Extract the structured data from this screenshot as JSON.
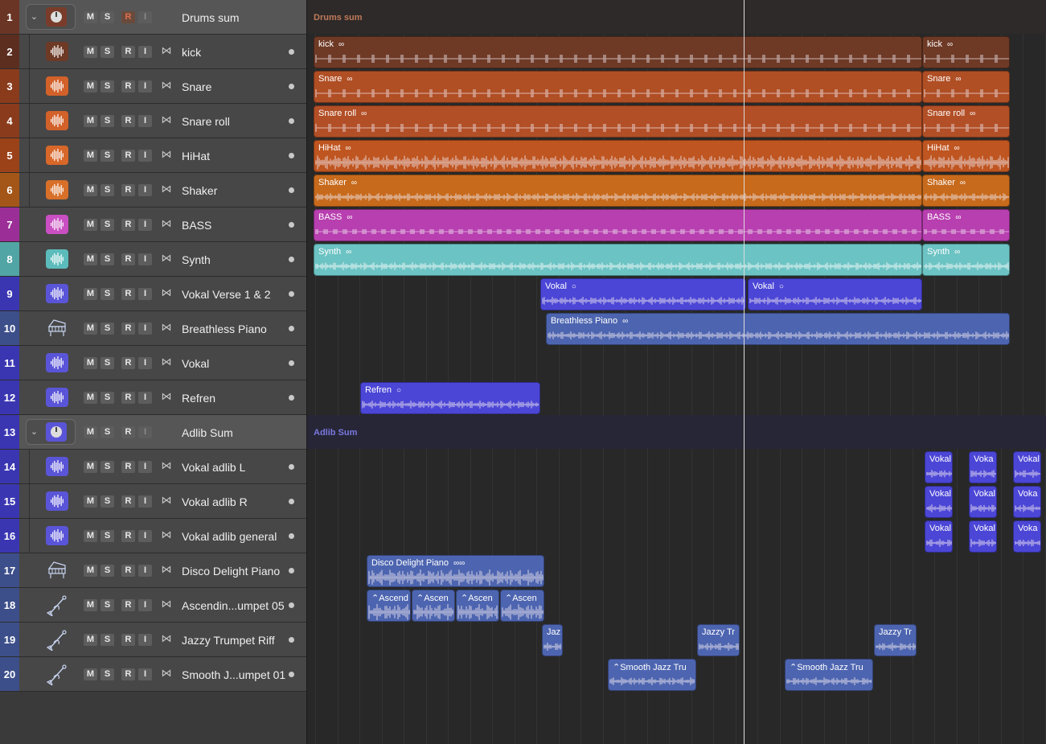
{
  "colors": {
    "drums_folder_icon": "#7a3c2a",
    "kick": "#6e3a26",
    "snare": "#b04e24",
    "snare_roll": "#b24f26",
    "hihat": "#bf5520",
    "shaker": "#c76a1c",
    "bass": "#b83fb0",
    "synth": "#6cc3c3",
    "vocal": "#4b46d6",
    "piano": "#4d65b0",
    "playhead": "#dcdcdc"
  },
  "buttons": {
    "mute": "M",
    "solo": "S",
    "rec": "R",
    "input": "I"
  },
  "tracks": [
    {
      "num": "1",
      "name": "Drums sum",
      "type": "folder",
      "icon": "drum-summing-icon",
      "numColor": "#6b3525"
    },
    {
      "num": "2",
      "name": "kick",
      "type": "audio",
      "icon": "waveform-icon",
      "numColor": "#5b2e20",
      "iconColor": "#6e3a26"
    },
    {
      "num": "3",
      "name": "Snare",
      "type": "audio",
      "icon": "waveform-icon",
      "numColor": "#8a3b1c",
      "iconColor": "#d2612a"
    },
    {
      "num": "4",
      "name": "Snare roll",
      "type": "audio",
      "icon": "waveform-icon",
      "numColor": "#8a3b1c",
      "iconColor": "#d2612a"
    },
    {
      "num": "5",
      "name": "HiHat",
      "type": "audio",
      "icon": "waveform-icon",
      "numColor": "#9c4219",
      "iconColor": "#d8672a"
    },
    {
      "num": "6",
      "name": "Shaker",
      "type": "audio",
      "icon": "waveform-icon",
      "numColor": "#a45618",
      "iconColor": "#d8702a"
    },
    {
      "num": "7",
      "name": "BASS",
      "type": "audio",
      "icon": "waveform-icon",
      "numColor": "#9c2f97",
      "iconColor": "#c94fc2"
    },
    {
      "num": "8",
      "name": "Synth",
      "type": "audio",
      "icon": "waveform-icon",
      "numColor": "#52a5a5",
      "iconColor": "#5cbcbc"
    },
    {
      "num": "9",
      "name": "Vokal Verse 1 & 2",
      "type": "audio",
      "icon": "waveform-icon",
      "numColor": "#3a36b2",
      "iconColor": "#5a55d8"
    },
    {
      "num": "10",
      "name": "Breathless Piano",
      "type": "instrument",
      "icon": "piano-icon",
      "numColor": "#3d4f8a"
    },
    {
      "num": "11",
      "name": "Vokal",
      "type": "audio",
      "icon": "waveform-icon",
      "numColor": "#3a36b2",
      "iconColor": "#5a55d8"
    },
    {
      "num": "12",
      "name": "Refren",
      "type": "audio",
      "icon": "waveform-icon",
      "numColor": "#3a36b2",
      "iconColor": "#5a55d8"
    },
    {
      "num": "13",
      "name": "Adlib Sum",
      "type": "folder",
      "icon": "summing-icon",
      "numColor": "#3a36b2"
    },
    {
      "num": "14",
      "name": "Vokal adlib L",
      "type": "audio",
      "icon": "waveform-icon",
      "numColor": "#3a36b2",
      "iconColor": "#5a55d8"
    },
    {
      "num": "15",
      "name": "Vokal adlib R",
      "type": "audio",
      "icon": "waveform-icon",
      "numColor": "#3a36b2",
      "iconColor": "#5a55d8"
    },
    {
      "num": "16",
      "name": "Vokal adlib general",
      "type": "audio",
      "icon": "waveform-icon",
      "numColor": "#3a36b2",
      "iconColor": "#5a55d8"
    },
    {
      "num": "17",
      "name": "Disco Delight Piano",
      "type": "instrument",
      "icon": "piano-icon",
      "numColor": "#3d4f8a"
    },
    {
      "num": "18",
      "name": "Ascendin...umpet 05",
      "type": "instrument",
      "icon": "trumpet-icon",
      "numColor": "#3d4f8a"
    },
    {
      "num": "19",
      "name": "Jazzy Trumpet Riff",
      "type": "instrument",
      "icon": "trumpet-icon",
      "numColor": "#3d4f8a"
    },
    {
      "num": "20",
      "name": "Smooth J...umpet 01",
      "type": "instrument",
      "icon": "trumpet-icon",
      "numColor": "#3d4f8a"
    }
  ],
  "summing": [
    {
      "track": 1,
      "label": "Drums sum",
      "labelColor": "#c0795a",
      "bg": "#2d2a29"
    },
    {
      "track": 13,
      "label": "Adlib Sum",
      "labelColor": "#7a78e0",
      "bg": "#262636"
    }
  ],
  "regions": [
    {
      "track": 2,
      "label": "kick",
      "loop": "∞",
      "color": "#6e3a26",
      "start": 0,
      "end": 757
    },
    {
      "track": 2,
      "label": "kick",
      "loop": "∞",
      "color": "#6e3a26",
      "start": 757,
      "end": 866
    },
    {
      "track": 3,
      "label": "Snare",
      "loop": "∞",
      "color": "#b04e24",
      "start": 0,
      "end": 757
    },
    {
      "track": 3,
      "label": "Snare",
      "loop": "∞",
      "color": "#b04e24",
      "start": 757,
      "end": 866
    },
    {
      "track": 4,
      "label": "Snare roll",
      "loop": "∞",
      "color": "#b24f26",
      "start": 0,
      "end": 757
    },
    {
      "track": 4,
      "label": "Snare roll",
      "loop": "∞",
      "color": "#b24f26",
      "start": 757,
      "end": 866
    },
    {
      "track": 5,
      "label": "HiHat",
      "loop": "∞",
      "color": "#bf5520",
      "start": 0,
      "end": 757
    },
    {
      "track": 5,
      "label": "HiHat",
      "loop": "∞",
      "color": "#bf5520",
      "start": 757,
      "end": 866
    },
    {
      "track": 6,
      "label": "Shaker",
      "loop": "∞",
      "color": "#c76a1c",
      "start": 0,
      "end": 757
    },
    {
      "track": 6,
      "label": "Shaker",
      "loop": "∞",
      "color": "#c76a1c",
      "start": 757,
      "end": 866
    },
    {
      "track": 7,
      "label": "BASS",
      "loop": "∞",
      "color": "#b83fb0",
      "start": 0,
      "end": 757
    },
    {
      "track": 7,
      "label": "BASS",
      "loop": "∞",
      "color": "#b83fb0",
      "start": 757,
      "end": 866
    },
    {
      "track": 8,
      "label": "Synth",
      "loop": "∞",
      "color": "#6cc3c3",
      "start": 0,
      "end": 757
    },
    {
      "track": 8,
      "label": "Synth",
      "loop": "∞",
      "color": "#6cc3c3",
      "start": 757,
      "end": 866
    },
    {
      "track": 9,
      "label": "Vokal",
      "loop": "○",
      "color": "#4b46d6",
      "start": 282,
      "end": 538
    },
    {
      "track": 9,
      "label": "Vokal",
      "loop": "○",
      "color": "#4b46d6",
      "start": 540,
      "end": 757
    },
    {
      "track": 10,
      "label": "Breathless Piano",
      "loop": "∞",
      "color": "#4d65b0",
      "start": 289,
      "end": 866
    },
    {
      "track": 12,
      "label": "Refren",
      "loop": "○",
      "color": "#4b46d6",
      "start": 58,
      "end": 282
    },
    {
      "track": 14,
      "label": "Vokal",
      "loop": "",
      "color": "#4b46d6",
      "start": 760,
      "end": 795
    },
    {
      "track": 14,
      "label": "Voka",
      "loop": "",
      "color": "#4b46d6",
      "start": 815,
      "end": 850
    },
    {
      "track": 14,
      "label": "Vokal",
      "loop": "",
      "color": "#4b46d6",
      "start": 870,
      "end": 905
    },
    {
      "track": 15,
      "label": "Vokal",
      "loop": "",
      "color": "#4b46d6",
      "start": 760,
      "end": 795
    },
    {
      "track": 15,
      "label": "Vokal",
      "loop": "",
      "color": "#4b46d6",
      "start": 815,
      "end": 850
    },
    {
      "track": 15,
      "label": "Voka",
      "loop": "",
      "color": "#4b46d6",
      "start": 870,
      "end": 905
    },
    {
      "track": 16,
      "label": "Vokal",
      "loop": "",
      "color": "#4b46d6",
      "start": 760,
      "end": 795
    },
    {
      "track": 16,
      "label": "Vokal",
      "loop": "",
      "color": "#4b46d6",
      "start": 815,
      "end": 850
    },
    {
      "track": 16,
      "label": "Voka",
      "loop": "",
      "color": "#4b46d6",
      "start": 870,
      "end": 905
    },
    {
      "track": 17,
      "label": "Disco Delight Piano",
      "loop": "∞∞",
      "color": "#4d65b0",
      "start": 66,
      "end": 287
    },
    {
      "track": 18,
      "label": "⌃Ascend",
      "loop": "",
      "color": "#4d65b0",
      "start": 66,
      "end": 121
    },
    {
      "track": 18,
      "label": "⌃Ascen",
      "loop": "",
      "color": "#4d65b0",
      "start": 122,
      "end": 176
    },
    {
      "track": 18,
      "label": "⌃Ascen",
      "loop": "",
      "color": "#4d65b0",
      "start": 177,
      "end": 231
    },
    {
      "track": 18,
      "label": "⌃Ascen",
      "loop": "",
      "color": "#4d65b0",
      "start": 232,
      "end": 287
    },
    {
      "track": 19,
      "label": "Jaz",
      "loop": "",
      "color": "#4d65b0",
      "start": 284,
      "end": 310
    },
    {
      "track": 19,
      "label": "Jazzy Tr",
      "loop": "",
      "color": "#4d65b0",
      "start": 477,
      "end": 530
    },
    {
      "track": 19,
      "label": "Jazzy Tr",
      "loop": "",
      "color": "#4d65b0",
      "start": 697,
      "end": 750
    },
    {
      "track": 20,
      "label": "⌃Smooth Jazz Tru",
      "loop": "",
      "color": "#4d65b0",
      "start": 366,
      "end": 476
    },
    {
      "track": 20,
      "label": "⌃Smooth Jazz Tru",
      "loop": "",
      "color": "#4d65b0",
      "start": 586,
      "end": 696
    }
  ]
}
